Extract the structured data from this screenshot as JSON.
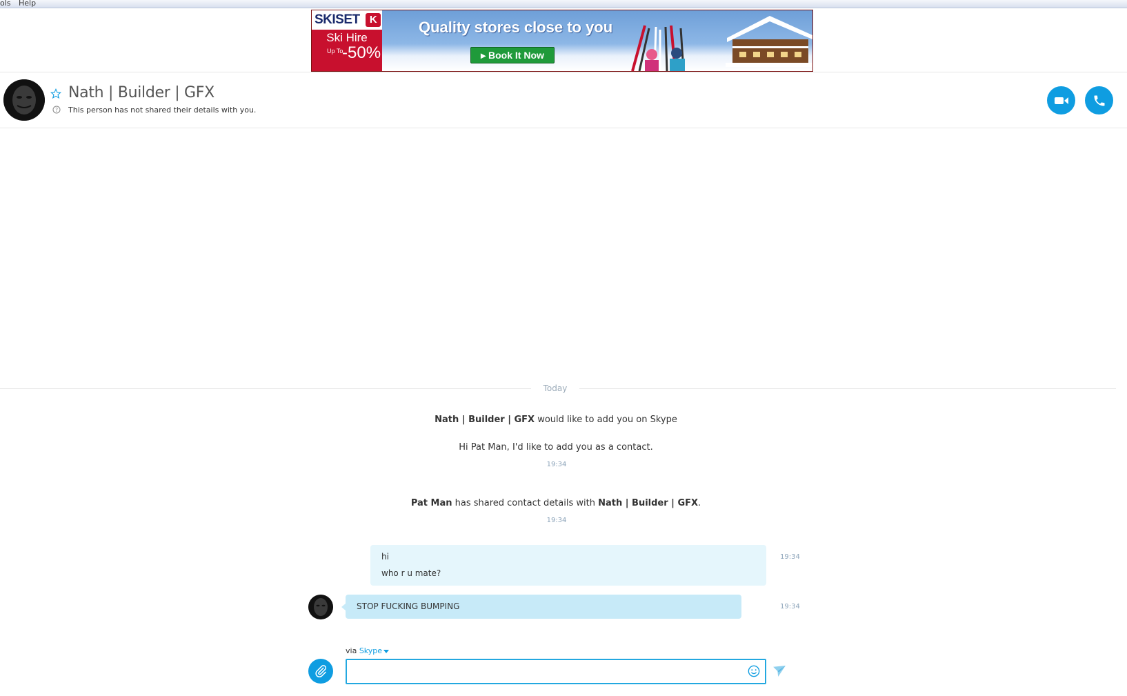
{
  "menubar": {
    "items": [
      "ols",
      "Help"
    ]
  },
  "ad": {
    "brand": "SKISET",
    "logo_letter": "K",
    "product": "Ski Hire",
    "up_to": "Up To",
    "discount": "-50%",
    "headline": "Quality stores close to you",
    "cta": "Book It Now"
  },
  "contact": {
    "name": "Nath | Builder | GFX",
    "note": "This person has not shared their details with you."
  },
  "chat": {
    "day_label": "Today",
    "system_messages": [
      {
        "name": "Nath | Builder | GFX",
        "text": " would like to add you on Skype"
      },
      {
        "text": "Hi Pat Man, I'd like to add you as a contact.",
        "time": "19:34"
      },
      {
        "name": "Pat Man",
        "text": " has shared contact details with ",
        "name2": "Nath | Builder | GFX",
        "end": ".",
        "time": "19:34"
      }
    ],
    "outgoing": {
      "lines": [
        "hi",
        "who r u mate?"
      ],
      "time": "19:34"
    },
    "incoming": {
      "text": "STOP FUCKING BUMPING",
      "time": "19:34"
    }
  },
  "composer": {
    "via_prefix": "via ",
    "via_service": "Skype",
    "value": "",
    "placeholder": ""
  },
  "colors": {
    "accent": "#0f9de1",
    "bubble_out": "#e5f6fc",
    "bubble_in": "#c7eaf8",
    "ad_red": "#c8102e"
  }
}
